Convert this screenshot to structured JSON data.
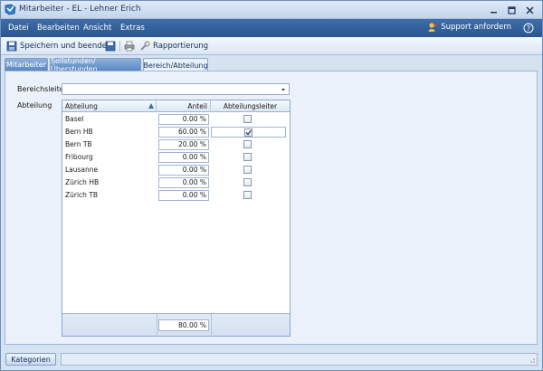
{
  "window": {
    "title": "Mitarbeiter - EL - Lehner Erich",
    "minimize_icon": "minimize-icon",
    "maximize_icon": "maximize-icon",
    "close_icon": "close-icon"
  },
  "menubar": {
    "items": [
      "Datei",
      "Bearbeiten",
      "Ansicht",
      "Extras"
    ],
    "support_label": "Support anfordern",
    "help_icon": "help-icon"
  },
  "toolbar": {
    "save_close_label": "Speichern und beenden",
    "report_label": "Rapportierung"
  },
  "tabs": [
    {
      "label": "Mitarbeiter",
      "active": false
    },
    {
      "label": "Sollstunden/Überstunden",
      "active": false
    },
    {
      "label": "Bereich/Abteilung",
      "active": true
    }
  ],
  "form": {
    "bereichsleiter_label": "Bereichsleiter",
    "bereichsleiter_value": "",
    "abteilung_label": "Abteilung"
  },
  "grid": {
    "columns": [
      "Abteilung",
      "Anteil",
      "Abteilungsleiter"
    ],
    "rows": [
      {
        "name": "Basel",
        "anteil": "0.00 %",
        "leiter": false
      },
      {
        "name": "Bern HB",
        "anteil": "60.00 %",
        "leiter": true
      },
      {
        "name": "Bern TB",
        "anteil": "20.00 %",
        "leiter": false
      },
      {
        "name": "Fribourg",
        "anteil": "0.00 %",
        "leiter": false
      },
      {
        "name": "Lausanne",
        "anteil": "0.00 %",
        "leiter": false
      },
      {
        "name": "Zürich HB",
        "anteil": "0.00 %",
        "leiter": false
      },
      {
        "name": "Zürich TB",
        "anteil": "0.00 %",
        "leiter": false
      }
    ],
    "total": "80.00 %"
  },
  "footer": {
    "kategorien_label": "Kategorien",
    "status_text": ""
  },
  "colors": {
    "menubar": "#2b5591",
    "panel": "#eaf1fa",
    "accent": "#3f6ea8"
  }
}
